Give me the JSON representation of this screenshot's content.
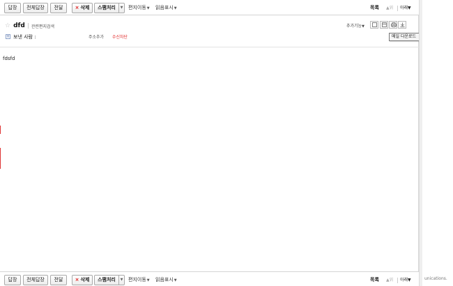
{
  "toolbar": {
    "reply": "답장",
    "reply_all": "전체답장",
    "forward": "전달",
    "delete": "삭제",
    "delete_icon": "×",
    "spam": "스팸처리",
    "move": "편지이동",
    "mark": "읽음표시",
    "list": "목록",
    "up": "위",
    "down": "아래"
  },
  "header": {
    "subject": "dfd",
    "related_search": "관련편지검색",
    "extra_functions": "추가기능",
    "sender_label": "보낸 사람 :",
    "add_address": "주소추가",
    "block_receive": "수신차단",
    "tooltip": "메일 다운로드"
  },
  "body": {
    "text": "fdsfd"
  },
  "right_pane": {
    "footer_fragment": "unications."
  },
  "colors": {
    "delete_x": "#e02020",
    "block_receive": "#e02020"
  },
  "icons": [
    "star-icon",
    "plus-icon",
    "view-icon",
    "window-icon",
    "print-icon",
    "download-icon"
  ]
}
